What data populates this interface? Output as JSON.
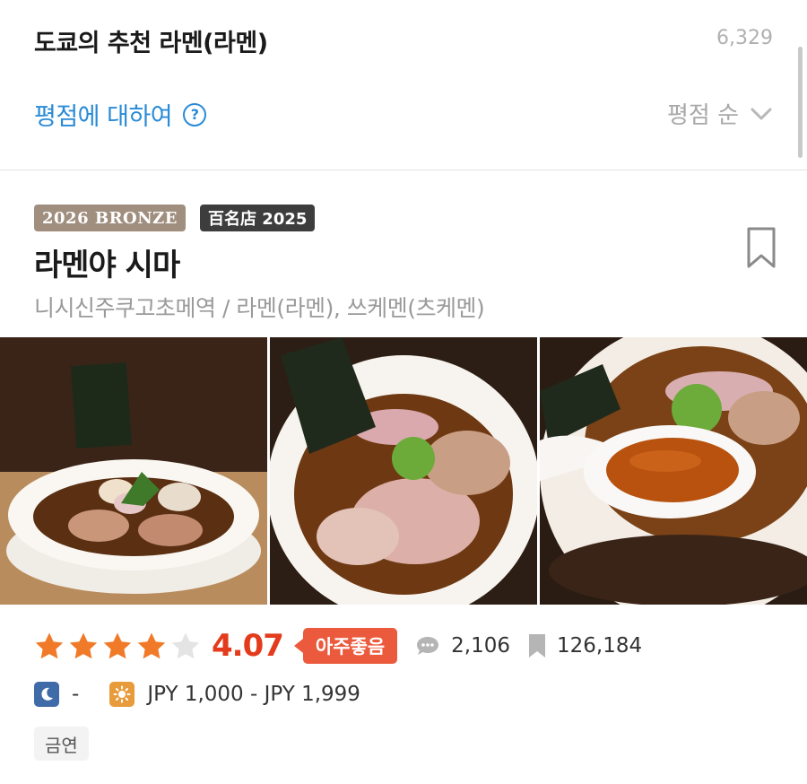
{
  "header": {
    "title": "도쿄의 추천 라멘(라멘)",
    "result_count": "6,329",
    "rating_about_label": "평점에 대하여",
    "sort_label": "평점 순"
  },
  "restaurant": {
    "badges": [
      "2026 BRONZE",
      "百名店 2025"
    ],
    "name": "라멘야 시마",
    "meta": "니시신주쿠고초메역 / 라멘(라멘), 쓰케멘(츠케멘)",
    "rating": {
      "value": 4.07,
      "display": "4.07",
      "stars_max": 5,
      "grade": "아주좋음"
    },
    "review_count": "2,106",
    "save_count": "126,184",
    "dinner_price": "-",
    "lunch_price": "JPY 1,000 - JPY 1,999",
    "tags": [
      "금연"
    ]
  },
  "colors": {
    "accent_blue": "#2a8bd6",
    "rating_red": "#e33b1c",
    "grade_badge": "#eb5a3c",
    "star": "#f07a28",
    "award_bronze": "#a08e7e"
  },
  "icons": {
    "help": "question-circle-icon",
    "sort": "chevron-down-icon",
    "bookmark": "bookmark-outline-icon",
    "reviews": "speech-bubble-icon",
    "saves": "bookmark-icon",
    "dinner": "moon-icon",
    "lunch": "sun-icon"
  }
}
